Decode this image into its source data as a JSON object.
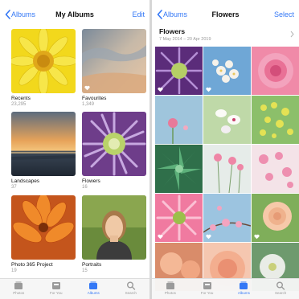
{
  "albums_screen": {
    "nav": {
      "back_label": "Albums",
      "title": "My Albums",
      "action_label": "Edit"
    },
    "albums": [
      {
        "name": "Recents",
        "count": "23,295",
        "icon": "sunflower",
        "favourite": false
      },
      {
        "name": "Favourites",
        "count": "1,349",
        "icon": "sunset-sky",
        "favourite": true
      },
      {
        "name": "Landscapes",
        "count": "37",
        "icon": "ocean-sunset",
        "favourite": false
      },
      {
        "name": "Flowers",
        "count": "16",
        "icon": "purple-flower",
        "favourite": false
      },
      {
        "name": "Photo 365 Project",
        "count": "19",
        "icon": "orange-lily",
        "favourite": false
      },
      {
        "name": "Portraits",
        "count": "15",
        "icon": "portrait",
        "favourite": false
      }
    ],
    "tabs": [
      {
        "label": "Photos",
        "icon": "photos-icon",
        "active": false
      },
      {
        "label": "For You",
        "icon": "for-you-icon",
        "active": false
      },
      {
        "label": "Albums",
        "icon": "albums-icon",
        "active": true
      },
      {
        "label": "Search",
        "icon": "search-icon",
        "active": false
      }
    ]
  },
  "flowers_screen": {
    "nav": {
      "back_label": "Albums",
      "title": "Flowers",
      "action_label": "Select"
    },
    "section": {
      "title": "Flowers",
      "date_range": "7 May 2014 – 20 Apr 2019"
    },
    "photos": [
      {
        "icon": "purple-daisy",
        "favourite": true
      },
      {
        "icon": "white-blossom",
        "favourite": true
      },
      {
        "icon": "pink-rose",
        "favourite": false
      },
      {
        "icon": "pink-bud",
        "favourite": false
      },
      {
        "icon": "white-orchid",
        "favourite": false
      },
      {
        "icon": "yellow-mimosa",
        "favourite": false
      },
      {
        "icon": "green-succulent",
        "favourite": false
      },
      {
        "icon": "pink-stems",
        "favourite": false
      },
      {
        "icon": "pink-blossom",
        "favourite": false
      },
      {
        "icon": "pink-gerbera",
        "favourite": true
      },
      {
        "icon": "cherry-blossom",
        "favourite": true
      },
      {
        "icon": "peony",
        "favourite": true
      },
      {
        "icon": "peach-dahlia",
        "favourite": false
      },
      {
        "icon": "pink-dahlia",
        "favourite": false
      },
      {
        "icon": "white-flower",
        "favourite": false
      }
    ],
    "tabs": [
      {
        "label": "Photos",
        "icon": "photos-icon",
        "active": false
      },
      {
        "label": "For You",
        "icon": "for-you-icon",
        "active": false
      },
      {
        "label": "Albums",
        "icon": "albums-icon",
        "active": true
      },
      {
        "label": "Search",
        "icon": "search-icon",
        "active": false
      }
    ]
  },
  "colors": {
    "accent": "#3478f6",
    "secondary_text": "#9a9a9a"
  }
}
